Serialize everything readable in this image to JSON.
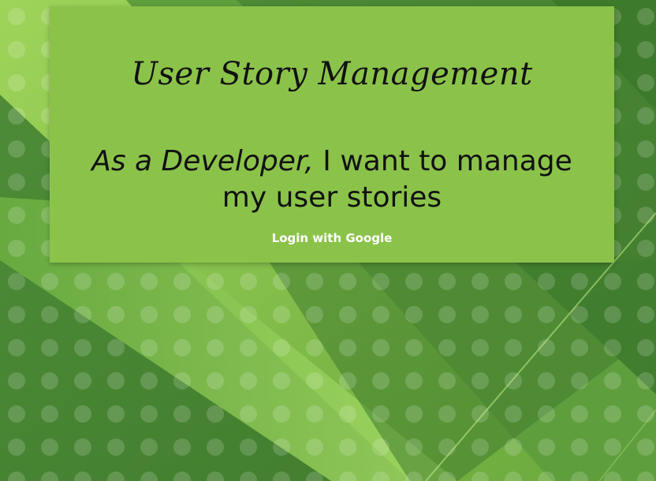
{
  "app_title": "User Story Management",
  "story": {
    "role": "As a Developer,",
    "goal": " I want to manage my user stories"
  },
  "login_button_label": "Login with Google",
  "colors": {
    "card_background": "#8bc34a",
    "page_background": "#4c8a3a",
    "text": "#111111",
    "button_text": "#ffffff"
  }
}
